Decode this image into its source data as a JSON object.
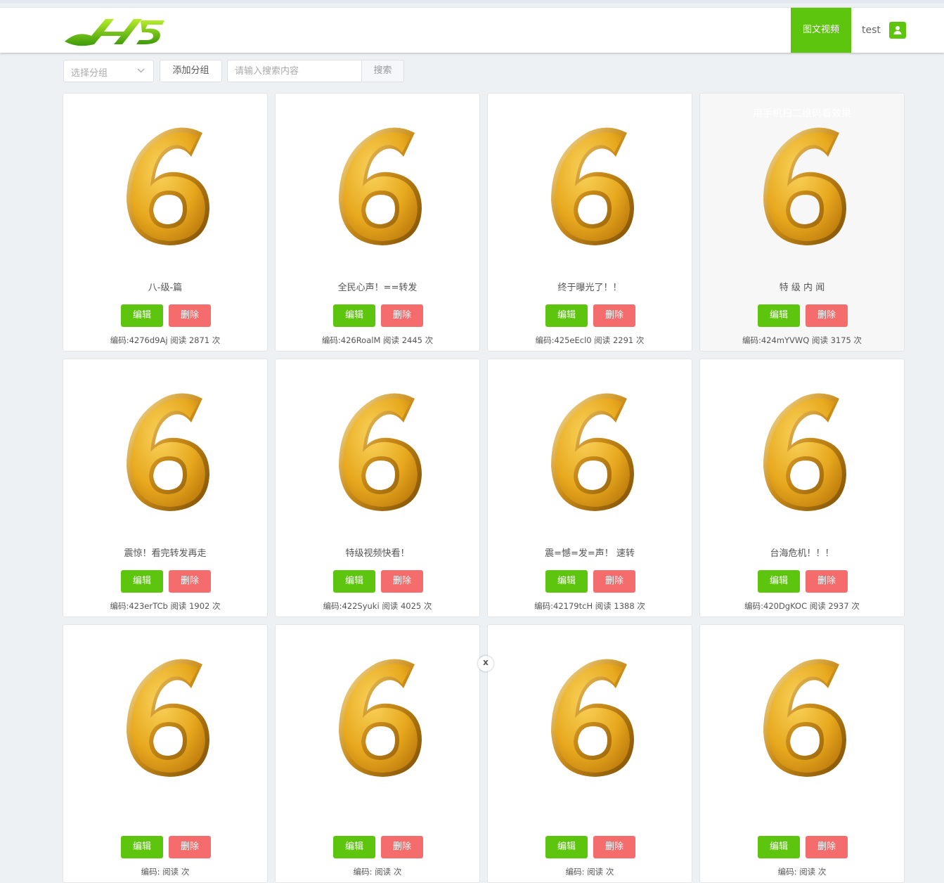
{
  "header": {
    "logo_text": "H5",
    "nav_active_label": "图文视频",
    "username": "test"
  },
  "toolbar": {
    "group_select_placeholder": "选择分组",
    "add_group_label": "添加分组",
    "search_placeholder": "请输入搜索内容",
    "search_label": "搜索"
  },
  "cards": [
    {
      "title": "八-级-篇",
      "code": "4276d9Aj",
      "reads": "2871"
    },
    {
      "title": "全民心声！==转发",
      "code": "426RoalM",
      "reads": "2445"
    },
    {
      "title": "终于曝光了！！",
      "code": "425eEcl0",
      "reads": "2291"
    },
    {
      "title": "特 级 内 闻",
      "code": "424mYVWQ",
      "reads": "3175",
      "qr_hint": "用手机扫二维码看效果"
    },
    {
      "title": "震惊！看完转发再走",
      "code": "423erTCb",
      "reads": "1902"
    },
    {
      "title": "特级视频快看！",
      "code": "422Syuki",
      "reads": "4025"
    },
    {
      "title": "震=憾=发=声！ 速转",
      "code": "42179tcH",
      "reads": "1388"
    },
    {
      "title": "台海危机！！！",
      "code": "420DgKOC",
      "reads": "2937"
    },
    {
      "title": "",
      "code": "",
      "reads": ""
    },
    {
      "title": "",
      "code": "",
      "reads": ""
    },
    {
      "title": "",
      "code": "",
      "reads": ""
    },
    {
      "title": "",
      "code": "",
      "reads": ""
    }
  ],
  "labels": {
    "edit": "编辑",
    "delete": "删除",
    "code_prefix": "编码:",
    "read_prefix": "阅读",
    "read_suffix": "次"
  },
  "colors": {
    "accent": "#5ec50e",
    "danger": "#f56c6c",
    "background": "#eef1f3"
  },
  "icons": {
    "thumbnail": "golden-number-six",
    "user": "user-icon",
    "select": "chevron-down-icon",
    "overlay_close": "close-icon"
  },
  "overlay": {
    "close_label": "x"
  }
}
